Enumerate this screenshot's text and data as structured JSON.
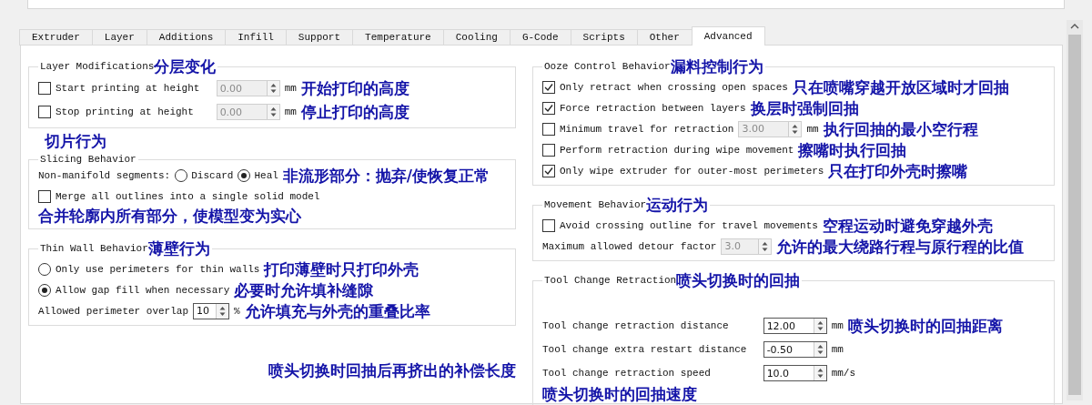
{
  "tabs": [
    {
      "label": "Extruder",
      "selected": false
    },
    {
      "label": "Layer",
      "selected": false
    },
    {
      "label": "Additions",
      "selected": false
    },
    {
      "label": "Infill",
      "selected": false
    },
    {
      "label": "Support",
      "selected": false
    },
    {
      "label": "Temperature",
      "selected": false
    },
    {
      "label": "Cooling",
      "selected": false
    },
    {
      "label": "G-Code",
      "selected": false
    },
    {
      "label": "Scripts",
      "selected": false
    },
    {
      "label": "Other",
      "selected": false
    },
    {
      "label": "Advanced",
      "selected": true
    }
  ],
  "left_groups": [
    {
      "title": "Layer Modifications",
      "kind": "form",
      "note": "分层变化",
      "rows": [
        {
          "kind": "check_spin",
          "label": "Start printing at height",
          "checked": false,
          "value": "0.00",
          "disabled": true,
          "unit": "mm",
          "note": "开始打印的高度"
        },
        {
          "kind": "check_spin",
          "label": "Stop printing at height",
          "checked": false,
          "value": "0.00",
          "disabled": true,
          "unit": "mm",
          "note": "停止打印的高度"
        }
      ]
    },
    {
      "title": "Slicing Behavior",
      "kind": "options",
      "note_above": "切片行为",
      "rows": [
        {
          "kind": "radio_group",
          "label": "Non-manifold segments:",
          "options": [
            {
              "label": "Discard",
              "selected": false
            },
            {
              "label": "Heal",
              "selected": true
            }
          ],
          "note": "非流形部分：抛弃/使恢复正常"
        },
        {
          "kind": "check",
          "label": "Merge all outlines into a single solid model",
          "checked": false,
          "note_below": "合并轮廓内所有部分，使模型变为实心"
        }
      ]
    },
    {
      "title": "Thin Wall Behavior",
      "kind": "options",
      "note": "薄壁行为",
      "rows": [
        {
          "kind": "radio",
          "label": "Only use perimeters for thin walls",
          "selected": false,
          "note": "打印薄壁时只打印外壳"
        },
        {
          "kind": "radio",
          "label": "Allow gap fill when necessary",
          "selected": true,
          "note": "必要时允许填补缝隙"
        },
        {
          "kind": "spin",
          "label": "Allowed perimeter overlap",
          "value": "10",
          "disabled": false,
          "unit": "%",
          "note": "允许填充与外壳的重叠比率"
        }
      ]
    }
  ],
  "left_note": "喷头切换时回抽后再挤出的补偿长度",
  "right_groups": [
    {
      "title": "Ooze Control Behavior",
      "kind": "options",
      "note": "漏料控制行为",
      "rows": [
        {
          "kind": "check",
          "label": "Only retract when crossing open spaces",
          "checked": true,
          "note": "只在喷嘴穿越开放区域时才回抽"
        },
        {
          "kind": "check",
          "label": "Force retraction between layers",
          "checked": true,
          "note": "换层时强制回抽"
        },
        {
          "kind": "check_spin",
          "label": "Minimum travel for retraction",
          "checked": false,
          "value": "3.00",
          "disabled": true,
          "unit": "mm",
          "note": "执行回抽的最小空行程"
        },
        {
          "kind": "check",
          "label": "Perform retraction during wipe movement",
          "checked": false,
          "note": "擦嘴时执行回抽"
        },
        {
          "kind": "check",
          "label": "Only wipe extruder for outer-most perimeters",
          "checked": true,
          "note": "只在打印外壳时擦嘴"
        }
      ]
    },
    {
      "title": "Movement Behavior",
      "kind": "options",
      "note": "运动行为",
      "rows": [
        {
          "kind": "check",
          "label": "Avoid crossing outline for travel movements",
          "checked": false,
          "note": "空程运动时避免穿越外壳"
        },
        {
          "kind": "spin",
          "label": "Maximum allowed detour factor",
          "value": "3.0",
          "disabled": true,
          "note": "允许的最大绕路行程与原行程的比值"
        }
      ]
    },
    {
      "title": "Tool Change Retraction",
      "kind": "form",
      "note": "喷头切换时的回抽",
      "rows": [
        {
          "kind": "spin",
          "label": "Tool change retraction distance",
          "value": "12.00",
          "disabled": false,
          "unit": "mm",
          "note": "喷头切换时的回抽距离"
        },
        {
          "kind": "spin",
          "label": "Tool change extra restart distance",
          "value": "-0.50",
          "disabled": false,
          "unit": "mm"
        },
        {
          "kind": "spin",
          "label": "Tool change retraction speed",
          "value": "10.0",
          "disabled": false,
          "unit": "mm/s",
          "note_below": "喷头切换时的回抽速度"
        }
      ]
    }
  ]
}
